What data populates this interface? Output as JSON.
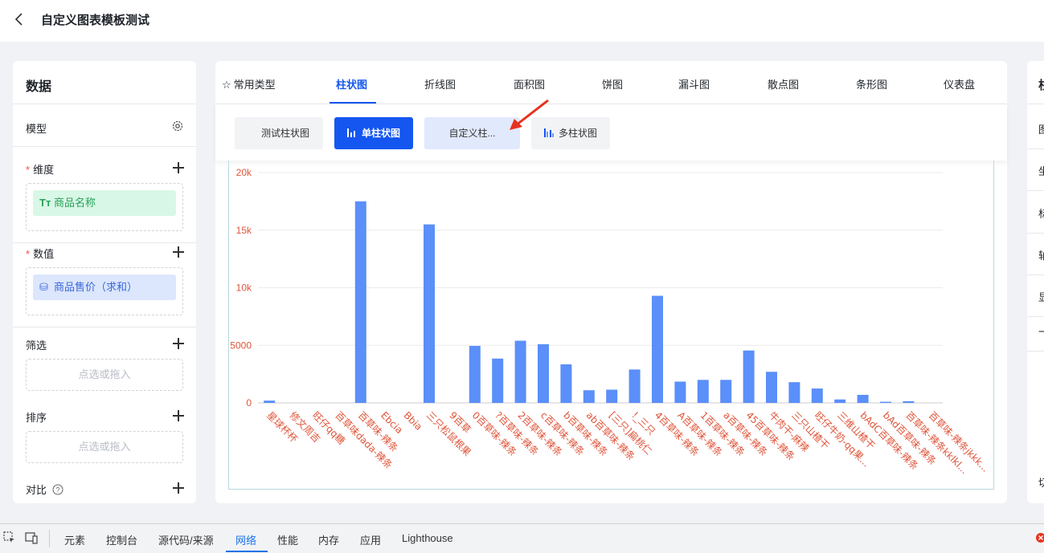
{
  "page": {
    "title": "自定义图表模板测试"
  },
  "left_panel": {
    "title": "数据",
    "model_label": "模型",
    "dimension": {
      "label": "维度",
      "required_mark": "*",
      "chip_icon": "Tт",
      "chip": "商品名称"
    },
    "measure": {
      "label": "数值",
      "required_mark": "*",
      "chip": "商品售价（求和）"
    },
    "filter": {
      "label": "筛选",
      "placeholder": "点选或拖入"
    },
    "sort": {
      "label": "排序",
      "placeholder": "点选或拖入"
    },
    "compare": {
      "label": "对比"
    }
  },
  "chart_tabs": [
    {
      "label": "常用类型"
    },
    {
      "label": "柱状图"
    },
    {
      "label": "折线图"
    },
    {
      "label": "面积图"
    },
    {
      "label": "饼图"
    },
    {
      "label": "漏斗图"
    },
    {
      "label": "散点图"
    },
    {
      "label": "条形图"
    },
    {
      "label": "仪表盘"
    }
  ],
  "active_tab": "柱状图",
  "subtypes": [
    {
      "label": "测试柱状图"
    },
    {
      "label": "单柱状图"
    },
    {
      "label": "自定义柱..."
    },
    {
      "label": "多柱状图"
    }
  ],
  "right_panel_labels": [
    "柱",
    "图",
    "坐",
    "标",
    "轴",
    "显",
    "一",
    "切"
  ],
  "devtools": {
    "tabs": [
      "元素",
      "控制台",
      "源代码/来源",
      "网络",
      "性能",
      "内存",
      "应用",
      "Lighthouse"
    ],
    "active": "网络"
  },
  "colors": {
    "bar": "#5b8ff9",
    "axis_label": "#e0553a",
    "primary": "#1456f0"
  },
  "chart_data": {
    "type": "bar",
    "title": "",
    "xlabel": "",
    "ylabel": "",
    "ylim": [
      0,
      20000
    ],
    "yticks": [
      "0",
      "5000",
      "10k",
      "15k",
      "20k"
    ],
    "grid": true,
    "categories": [
      "星球杯杯",
      "修文周吉",
      "旺仔qq糖",
      "百草味dada-辣条",
      "百草味-辣条",
      "Ebcia",
      "Bbia",
      "三只松鼠根果",
      "9百草",
      "0百草味-辣条",
      "?百草味-辣条",
      "2百草味-辣条",
      "c百草味-辣条",
      "b百草味-辣条",
      "ab百草味-辣条",
      "[三只]扁桃仁",
      "!_三只",
      "4百草味-辣条",
      "A百草味-辣条",
      "1百草味-辣条",
      "a百草味-辣条",
      "45百草味-辣条",
      "牛肉干-麻辣",
      "三只山楂干",
      "旺仔牛奶-qq果...",
      "三维山楂干",
      "bAdC百草味-辣条",
      "bAd百草味-辣条",
      "百草味-辣条kklkl...",
      "百草味-辣条jkkk..."
    ],
    "values": [
      200,
      0,
      0,
      0,
      17500,
      0,
      0,
      15500,
      0,
      4950,
      3850,
      5400,
      5100,
      3350,
      1100,
      1150,
      2900,
      9300,
      1850,
      2000,
      2000,
      4550,
      2700,
      1800,
      1250,
      300,
      700,
      100,
      150,
      0
    ]
  }
}
